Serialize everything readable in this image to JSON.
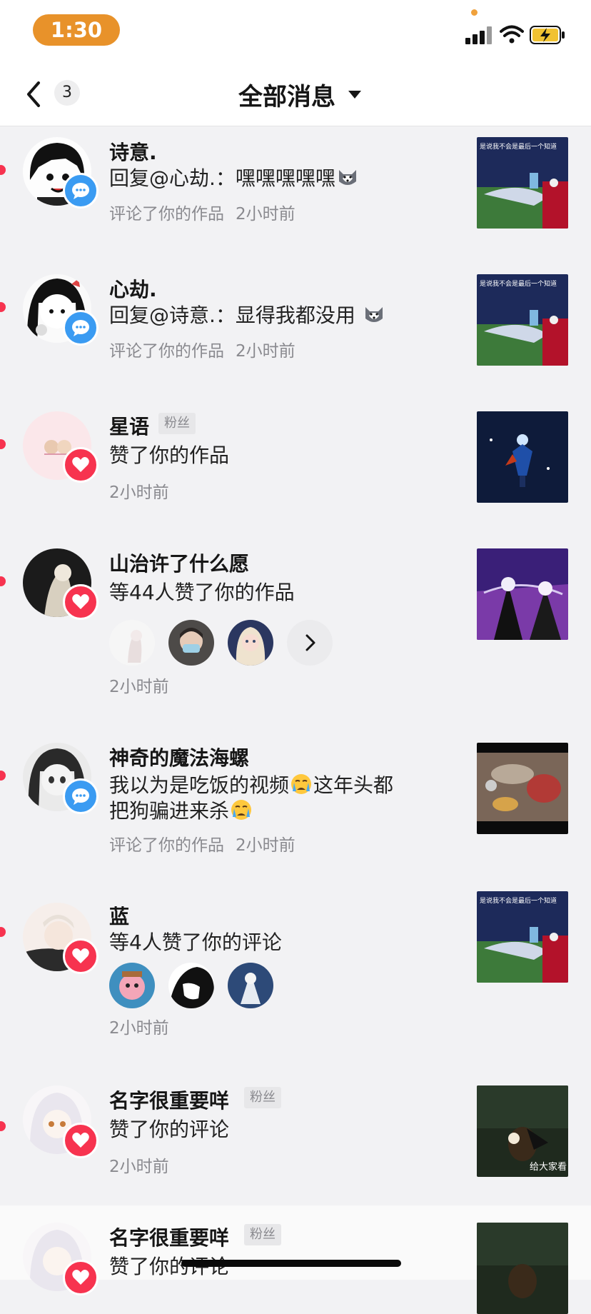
{
  "status_bar": {
    "time": "1:30"
  },
  "header": {
    "back_count": "3",
    "title": "全部消息"
  },
  "items": [
    {
      "name": "诗意.",
      "message": "回复@心劫.：嘿嘿嘿嘿嘿",
      "action": "评论了你的作品",
      "time": "2小时前",
      "type": "comment"
    },
    {
      "name": "心劫.",
      "message": "回复@诗意.：显得我都没用",
      "action": "评论了你的作品",
      "time": "2小时前",
      "type": "comment"
    },
    {
      "name": "星语",
      "tag": "粉丝",
      "message": "赞了你的作品",
      "time": "2小时前",
      "type": "like"
    },
    {
      "name": "山治许了什么愿",
      "message": "等44人赞了你的作品",
      "time": "2小时前",
      "type": "like"
    },
    {
      "name": "神奇的魔法海螺",
      "message_line1": "我以为是吃饭的视频",
      "message_line1b": "这年头都",
      "message_line2": "把狗骗进来杀",
      "action": "评论了你的作品",
      "time": "2小时前",
      "type": "comment"
    },
    {
      "name": "蓝",
      "message": "等4人赞了你的评论",
      "time": "2小时前",
      "type": "like"
    },
    {
      "name": "名字很重要咩",
      "tag": "粉丝",
      "message": "赞了你的评论",
      "time": "2小时前",
      "type": "like",
      "thumb_caption": "给大家看"
    },
    {
      "name": "名字很重要咩",
      "tag": "粉丝",
      "message": "赞了你的评论",
      "type": "like"
    }
  ],
  "thumb_text": {
    "sky_caption": "是说我不会是最后一个知道"
  },
  "colors": {
    "accent_red": "#f7334f",
    "comment_blue": "#3a9bf2",
    "time_pill": "#e8922a"
  },
  "icons": [
    "back-chevron-icon",
    "caret-down-icon",
    "comment-bubble-icon",
    "heart-icon",
    "chevron-right-icon",
    "signal-icon",
    "wifi-icon",
    "battery-charging-icon"
  ]
}
